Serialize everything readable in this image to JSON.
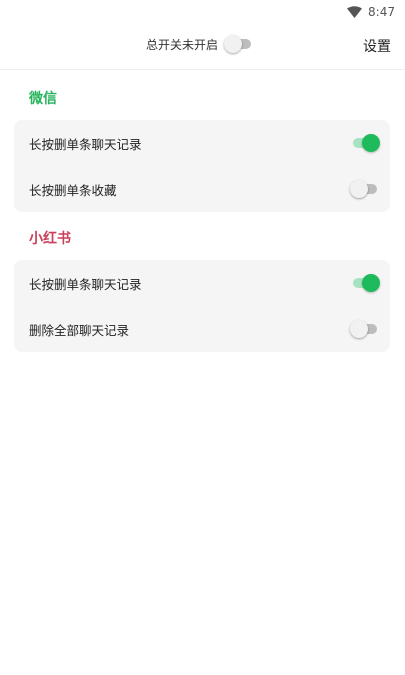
{
  "status_bar": {
    "time": "8:47",
    "wifi_icon": "wifi-icon"
  },
  "header": {
    "master_switch_label": "总开关未开启",
    "master_switch_on": false,
    "settings_label": "设置"
  },
  "colors": {
    "wechat": "#27b35c",
    "xiaohongshu": "#c9405c",
    "switch_on": "#1fba5b"
  },
  "sections": [
    {
      "title": "微信",
      "items": [
        {
          "label": "长按删单条聊天记录",
          "on": true
        },
        {
          "label": "长按删单条收藏",
          "on": false
        }
      ]
    },
    {
      "title": "小红书",
      "items": [
        {
          "label": "长按删单条聊天记录",
          "on": true
        },
        {
          "label": "删除全部聊天记录",
          "on": false
        }
      ]
    }
  ]
}
